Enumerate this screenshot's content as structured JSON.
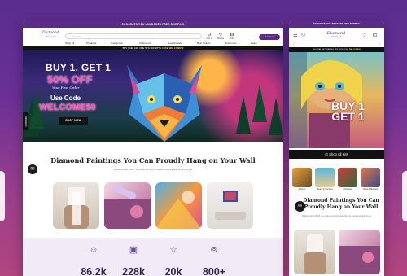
{
  "announcement": "CONGRATS YOU UNLOCKED FREE SHIPPING",
  "brand": {
    "name": "Diamond",
    "tag": "ART CLUB"
  },
  "search": {
    "placeholder": "Search"
  },
  "header_icons": [
    {
      "icon": "user-icon",
      "label": "Sign In"
    },
    {
      "icon": "heart-icon",
      "label": "Wishlist"
    },
    {
      "icon": "cart-icon",
      "label": "Cart"
    }
  ],
  "account_button": "Account",
  "menu": [
    "Shop All",
    "Products",
    "Categories",
    "Collections",
    "New Arrivals",
    "Best Sellers",
    "Resources",
    "Learn"
  ],
  "promo": {
    "text": "BUY ONE, GET ONE 50% OFF WITH CODE",
    "code": "WELCOME50"
  },
  "hero": {
    "line1": "BUY 1, GET 1",
    "line2": "50% OFF",
    "line3": "Your First Order",
    "line4": "Use Code",
    "line5": "WELCOME50",
    "button": "SHOP NOW",
    "rewards": "REWARDS"
  },
  "section": {
    "heading": "Diamond Paintings You Can Proudly Hang on Your Wall",
    "sub": "At Diamond Art Club®, we curate every kit by featuring only the best designs for you"
  },
  "stats": [
    {
      "icon": "smile-icon",
      "value": "86.2k"
    },
    {
      "icon": "box-icon",
      "value": "228k"
    },
    {
      "icon": "star-icon",
      "value": "20k"
    },
    {
      "icon": "badge-icon",
      "value": "800+"
    }
  ],
  "mobile": {
    "hero_line1": "BUY 1",
    "hero_line2": "GET 1",
    "shop_all": "Shop All Kits",
    "categories": [
      "Animals",
      "Beach & Summer",
      "Christmas",
      "Cities & Skylines"
    ],
    "heading": "Diamond Paintings You Can Proudly Hang on Your Wall",
    "sub": "At Diamond Art Club®, we curate every kit by featuring only the best designs for you"
  },
  "colors": {
    "brand": "#5b2c86",
    "accent": "#ff4db8",
    "stats_bg": "#f1ebf8"
  }
}
